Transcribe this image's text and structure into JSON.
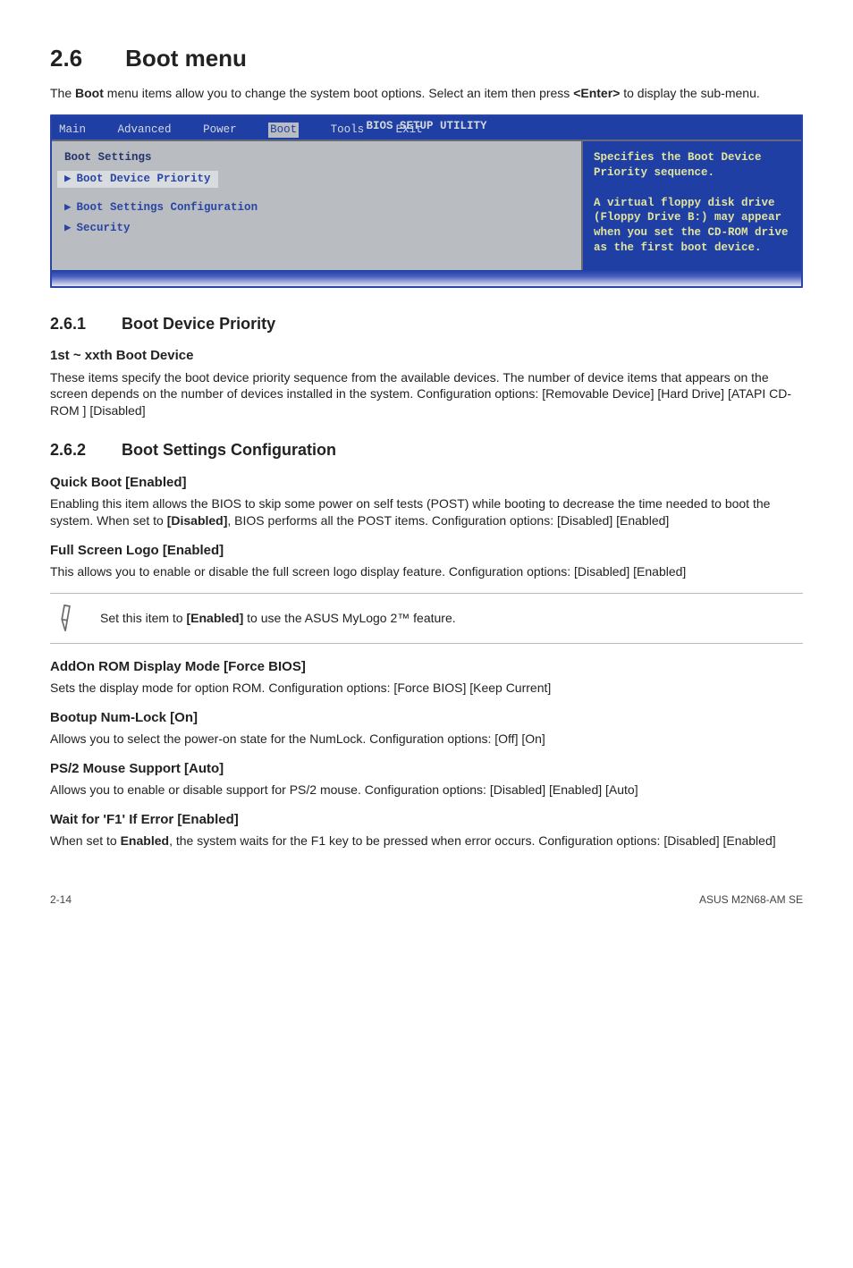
{
  "header": {
    "section_number": "2.6",
    "section_title": "Boot menu",
    "intro_pre": "The ",
    "intro_bold1": "Boot",
    "intro_mid": " menu items allow you to change the system boot options. Select an item then press ",
    "intro_bold2": "<Enter>",
    "intro_end": " to display the sub-menu."
  },
  "bios": {
    "title": "BIOS SETUP UTILITY",
    "tabs": [
      "Main",
      "Advanced",
      "Power",
      "Boot",
      "Tools",
      "Exit"
    ],
    "active_index": 3,
    "left_title": "Boot Settings",
    "rows": {
      "bdp": "Boot Device Priority",
      "bsc": "Boot Settings Configuration",
      "sec": "Security"
    },
    "help_text": "Specifies the Boot Device Priority sequence.\n\nA virtual floppy disk drive (Floppy Drive B:) may appear when you set the CD-ROM drive as the first boot device."
  },
  "s261": {
    "num": "2.6.1",
    "title": "Boot Device Priority",
    "setting_h": "1st ~ xxth Boot Device",
    "para": "These items specify the boot device priority sequence from the available devices. The number of device items that appears on the screen depends on the number of devices installed in the system. Configuration options: [Removable Device] [Hard Drive] [ATAPI CD-ROM ] [Disabled]"
  },
  "s262": {
    "num": "2.6.2",
    "title": "Boot Settings Configuration",
    "quick_h": "Quick Boot [Enabled]",
    "quick_p_pre": "Enabling this item allows the BIOS to skip some power on self tests (POST) while booting to decrease the time needed to boot the system. When set to ",
    "quick_bold": "[Disabled]",
    "quick_p_post": ", BIOS performs all the POST items. Configuration options: [Disabled] [Enabled]",
    "full_h": "Full Screen Logo [Enabled]",
    "full_p": "This allows you to enable or disable the full screen logo display feature. Configuration options: [Disabled] [Enabled]",
    "note_pre": "Set this item to ",
    "note_bold": "[Enabled]",
    "note_post": " to use the ASUS MyLogo 2™ feature.",
    "addon_h": "AddOn ROM Display Mode [Force BIOS]",
    "addon_p": "Sets the display mode for option ROM. Configuration options: [Force BIOS] [Keep Current]",
    "numlock_h": "Bootup Num-Lock [On]",
    "numlock_p": "Allows you to select the power-on state for the NumLock. Configuration options: [Off] [On]",
    "ps2_h": "PS/2 Mouse Support [Auto]",
    "ps2_p": "Allows you to enable or disable support for PS/2 mouse. Configuration options: [Disabled] [Enabled] [Auto]",
    "wait_h": "Wait for 'F1' If Error [Enabled]",
    "wait_pre": "When set to ",
    "wait_bold": "Enabled",
    "wait_post": ", the system waits for the F1 key to be pressed when error occurs. Configuration options: [Disabled] [Enabled]"
  },
  "footer": {
    "page": "2-14",
    "prod": "ASUS M2N68-AM SE"
  }
}
